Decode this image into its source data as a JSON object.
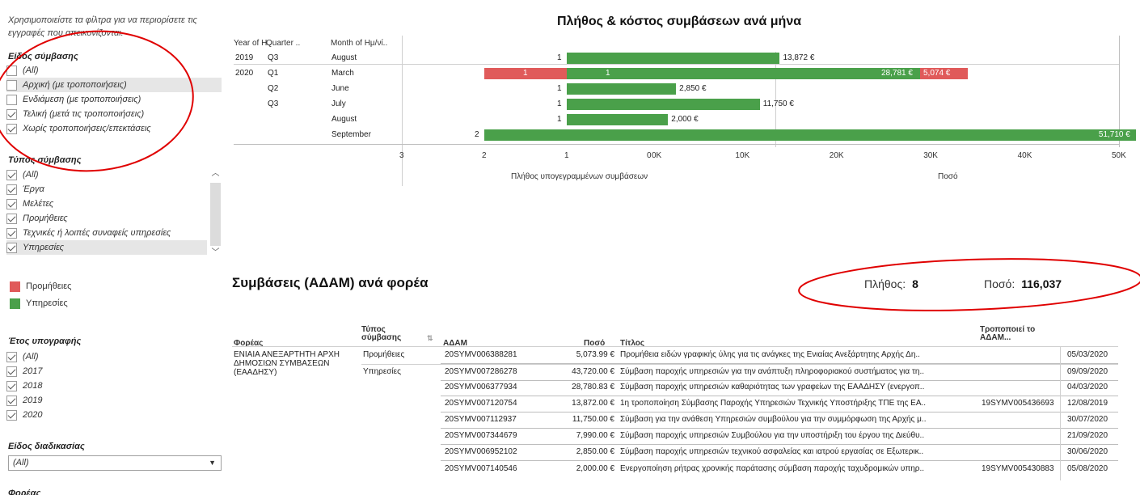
{
  "filters": {
    "hint": "Χρησιμοποιείστε τα φίλτρα για να περιορίσετε τις εγγραφές που απεικονίζονται.",
    "contract_kind": {
      "title": "Είδος σύμβασης",
      "items": [
        {
          "label": "(All)",
          "checked": false
        },
        {
          "label": "Αρχική (με τροποποιήσεις)",
          "checked": false
        },
        {
          "label": "Ενδιάμεση (με τροποποιήσεις)",
          "checked": false
        },
        {
          "label": "Τελική (μετά τις τροποποιήσεις)",
          "checked": true
        },
        {
          "label": "Χωρίς τροποποιήσεις/επεκτάσεις",
          "checked": true
        }
      ]
    },
    "contract_type": {
      "title": "Τύπος σύμβασης",
      "items": [
        {
          "label": "(All)",
          "checked": true
        },
        {
          "label": "Έργα",
          "checked": true
        },
        {
          "label": "Μελέτες",
          "checked": true
        },
        {
          "label": "Προμήθειες",
          "checked": true
        },
        {
          "label": "Τεχνικές ή λοιπές συναφείς υπηρεσίες",
          "checked": true
        },
        {
          "label": "Υπηρεσίες",
          "checked": true
        }
      ]
    },
    "legend": [
      {
        "label": "Προμήθειες",
        "color": "#e05a5a"
      },
      {
        "label": "Υπηρεσίες",
        "color": "#4aa04a"
      }
    ],
    "year": {
      "title": "Έτος υπογραφής",
      "items": [
        {
          "label": "(All)",
          "checked": true
        },
        {
          "label": "2017",
          "checked": true
        },
        {
          "label": "2018",
          "checked": true
        },
        {
          "label": "2019",
          "checked": true
        },
        {
          "label": "2020",
          "checked": true
        }
      ]
    },
    "procedure": {
      "title": "Είδος διαδικασίας",
      "value": "(All)"
    },
    "agency": {
      "title": "Φορέας"
    }
  },
  "chart": {
    "title": "Πλήθος & κόστος συμβάσεων ανά μήνα",
    "headers": {
      "year": "Year of H..",
      "quarter": "Quarter ..",
      "month": "Month of Ημ/νί.."
    },
    "rows": [
      {
        "year": "2019",
        "quarter": "Q3",
        "month": "August",
        "count_prom": 0,
        "count_yp": 1,
        "amount_prom": 0,
        "amount_yp": 13872,
        "amount_label": "13,872 €"
      },
      {
        "year": "2020",
        "quarter": "Q1",
        "month": "March",
        "count_prom": 1,
        "count_yp": 1,
        "amount_prom": 5074,
        "amount_yp": 28781,
        "amount_label": "28,781 €",
        "amount_label_prom": "5,074 €"
      },
      {
        "year": "",
        "quarter": "Q2",
        "month": "June",
        "count_prom": 0,
        "count_yp": 1,
        "amount_prom": 0,
        "amount_yp": 2850,
        "amount_label": "2,850 €"
      },
      {
        "year": "",
        "quarter": "Q3",
        "month": "July",
        "count_prom": 0,
        "count_yp": 1,
        "amount_prom": 0,
        "amount_yp": 11750,
        "amount_label": "11,750 €"
      },
      {
        "year": "",
        "quarter": "",
        "month": "August",
        "count_prom": 0,
        "count_yp": 1,
        "amount_prom": 0,
        "amount_yp": 2000,
        "amount_label": "2,000 €"
      },
      {
        "year": "",
        "quarter": "",
        "month": "September",
        "count_prom": 0,
        "count_yp": 2,
        "amount_prom": 0,
        "amount_yp": 51710,
        "amount_label": "51,710 €"
      }
    ],
    "count_ticks": [
      "3",
      "2",
      "1",
      "0"
    ],
    "amount_ticks": [
      "0K",
      "10K",
      "20K",
      "30K",
      "40K",
      "50K"
    ],
    "count_axis_title": "Πλήθος υπογεγραμμένων συμβάσεων",
    "amount_axis_title": "Ποσό"
  },
  "chart_data": {
    "type": "bar",
    "title": "Πλήθος & κόστος συμβάσεων ανά μήνα",
    "categories": [
      "2019 Q3 August",
      "2020 Q1 March",
      "2020 Q2 June",
      "2020 Q3 July",
      "2020 Q3 August",
      "2020 Q3 September"
    ],
    "series": [
      {
        "name": "Προμήθειες",
        "count": [
          0,
          1,
          0,
          0,
          0,
          0
        ],
        "amount": [
          0,
          5074,
          0,
          0,
          0,
          0
        ]
      },
      {
        "name": "Υπηρεσίες",
        "count": [
          1,
          1,
          1,
          1,
          1,
          2
        ],
        "amount": [
          13872,
          28781,
          2850,
          11750,
          2000,
          51710
        ]
      }
    ],
    "xlabel_left": "Πλήθος υπογεγραμμένων συμβάσεων",
    "xlabel_right": "Ποσό",
    "count_range": [
      0,
      3
    ],
    "amount_range": [
      0,
      50000
    ]
  },
  "table": {
    "title": "Συμβάσεις (ΑΔΑΜ) ανά φορέα",
    "kpi_count_label": "Πλήθος:",
    "kpi_count": "8",
    "kpi_amount_label": "Ποσό:",
    "kpi_amount": "116,037",
    "headers": {
      "agency": "Φορέας",
      "type": "Τύπος σύμβασης",
      "adam": "ΑΔΑΜ",
      "amount": "Ποσό",
      "title": "Τίτλος",
      "mod": "Τροποποιεί το ΑΔΑΜ..."
    },
    "agency": "ΕΝΙΑΙΑ ΑΝΕΞΑΡΤΗΤΗ ΑΡΧΗ ΔΗΜΟΣΙΩΝ ΣΥΜΒΑΣΕΩΝ (ΕΑΑΔΗΣΥ)",
    "type_prom": "Προμήθειες",
    "type_yp": "Υπηρεσίες",
    "rows": [
      {
        "adam": "20SYMV006388281",
        "amount": "5,073.99 €",
        "title": "Προμήθεια ειδών γραφικής ύλης για τις ανάγκες της Ενιαίας Ανεξάρτητης Αρχής Δη..",
        "mod": "",
        "date": "05/03/2020"
      },
      {
        "adam": "20SYMV007286278",
        "amount": "43,720.00 €",
        "title": "Σύμβαση παροχής υπηρεσιών για την ανάπτυξη πληροφοριακού συστήματος για τη..",
        "mod": "",
        "date": "09/09/2020"
      },
      {
        "adam": "20SYMV006377934",
        "amount": "28,780.83 €",
        "title": "Σύμβαση παροχής υπηρεσιών καθαριότητας των γραφείων της ΕΑΑΔΗΣΥ (ενεργοπ..",
        "mod": "",
        "date": "04/03/2020"
      },
      {
        "adam": "20SYMV007120754",
        "amount": "13,872.00 €",
        "title": "1η τροποποίηση Σύμβασης Παροχής Υπηρεσιών Τεχνικής Υποστήριξης ΤΠΕ της ΕΑ..",
        "mod": "19SYMV005436693",
        "date": "12/08/2019"
      },
      {
        "adam": "20SYMV007112937",
        "amount": "11,750.00 €",
        "title": "Σύμβαση για την ανάθεση Υπηρεσιών συμβούλου για την συμμόρφωση της Αρχής μ..",
        "mod": "",
        "date": "30/07/2020"
      },
      {
        "adam": "20SYMV007344679",
        "amount": "7,990.00 €",
        "title": "Σύμβαση παροχής υπηρεσιών Συμβούλου για την υποστήριξη του έργου της Διεύθυ..",
        "mod": "",
        "date": "21/09/2020"
      },
      {
        "adam": "20SYMV006952102",
        "amount": "2,850.00 €",
        "title": "Σύμβαση παροχής υπηρεσιών τεχνικού ασφαλείας και ιατρού εργασίας σε Εξωτερικ..",
        "mod": "",
        "date": "30/06/2020"
      },
      {
        "adam": "20SYMV007140546",
        "amount": "2,000.00 €",
        "title": "Ενεργοποίηση ρήτρας χρονικής παράτασης σύμβαση παροχής ταχυδρομικών υπηρ..",
        "mod": "19SYMV005430883",
        "date": "05/08/2020"
      }
    ]
  },
  "colors": {
    "prom": "#e05a5a",
    "yp": "#4aa04a",
    "annotation": "#e00000"
  }
}
